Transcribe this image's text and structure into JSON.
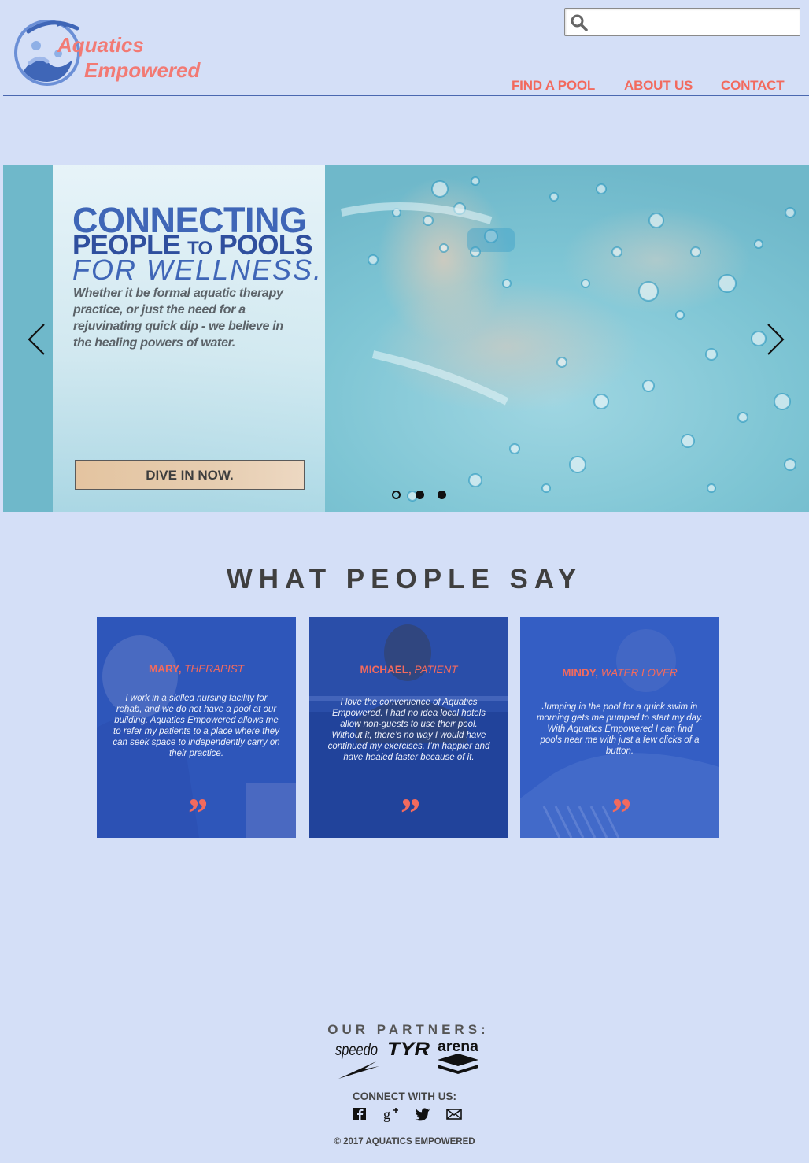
{
  "brand": {
    "line1": "Aquatics",
    "line2": "Empowered",
    "logo_color": "#f27a74",
    "mark_color": "#3f66b7"
  },
  "search": {
    "value": "",
    "icon": "search-icon"
  },
  "nav": {
    "items": [
      {
        "label": "FIND A POOL"
      },
      {
        "label": "ABOUT US"
      },
      {
        "label": "CONTACT"
      }
    ],
    "color": "#f26a5e"
  },
  "hero": {
    "heading_line1": "CONNECTING",
    "heading_line2_a": "PEOPLE ",
    "heading_line2_to": "TO",
    "heading_line2_b": " POOLS",
    "heading_line3": "FOR WELLNESS.",
    "body": "Whether it be formal aquatic therapy practice, or just the need for a rejuvinating quick dip - we believe in the healing powers of water.",
    "cta_label": "DIVE IN NOW.",
    "prev_icon": "chevron-left-icon",
    "next_icon": "chevron-right-icon",
    "slide_count": 3,
    "active_slide": 1
  },
  "testimonials": {
    "title": "WHAT PEOPLE SAY",
    "items": [
      {
        "name": "MARY,",
        "role": "THERAPIST",
        "text": "I work in a skilled nursing facility for rehab, and we do not have a pool at our building. Aquatics Empowered allows me to refer my patients to a place where they can seek space to independently carry on their practice.",
        "quote": "”"
      },
      {
        "name": "MICHAEL,",
        "role": "PATIENT",
        "text": "I love the convenience of Aquatics Empowered. I had no idea local hotels allow non-guests to use their pool. Without it, there’s no way I would have continued my exercises. I’m happier and have healed faster because of it.",
        "quote": "”"
      },
      {
        "name": "MINDY,",
        "role": "WATER LOVER",
        "text": "Jumping in the pool for a quick swim in morning gets me pumped to start my day. With Aquatics Empowered I can find pools near me with just a few clicks of a button.",
        "quote": "”"
      }
    ]
  },
  "footer": {
    "partners_title": "OUR PARTNERS:",
    "partners": [
      "speedo",
      "TYR",
      "arena"
    ],
    "connect_label": "CONNECT WITH US:",
    "social": [
      "facebook-icon",
      "google-plus-icon",
      "twitter-icon",
      "mail-icon"
    ],
    "copyright": "© 2017 AQUATICS EMPOWERED"
  }
}
